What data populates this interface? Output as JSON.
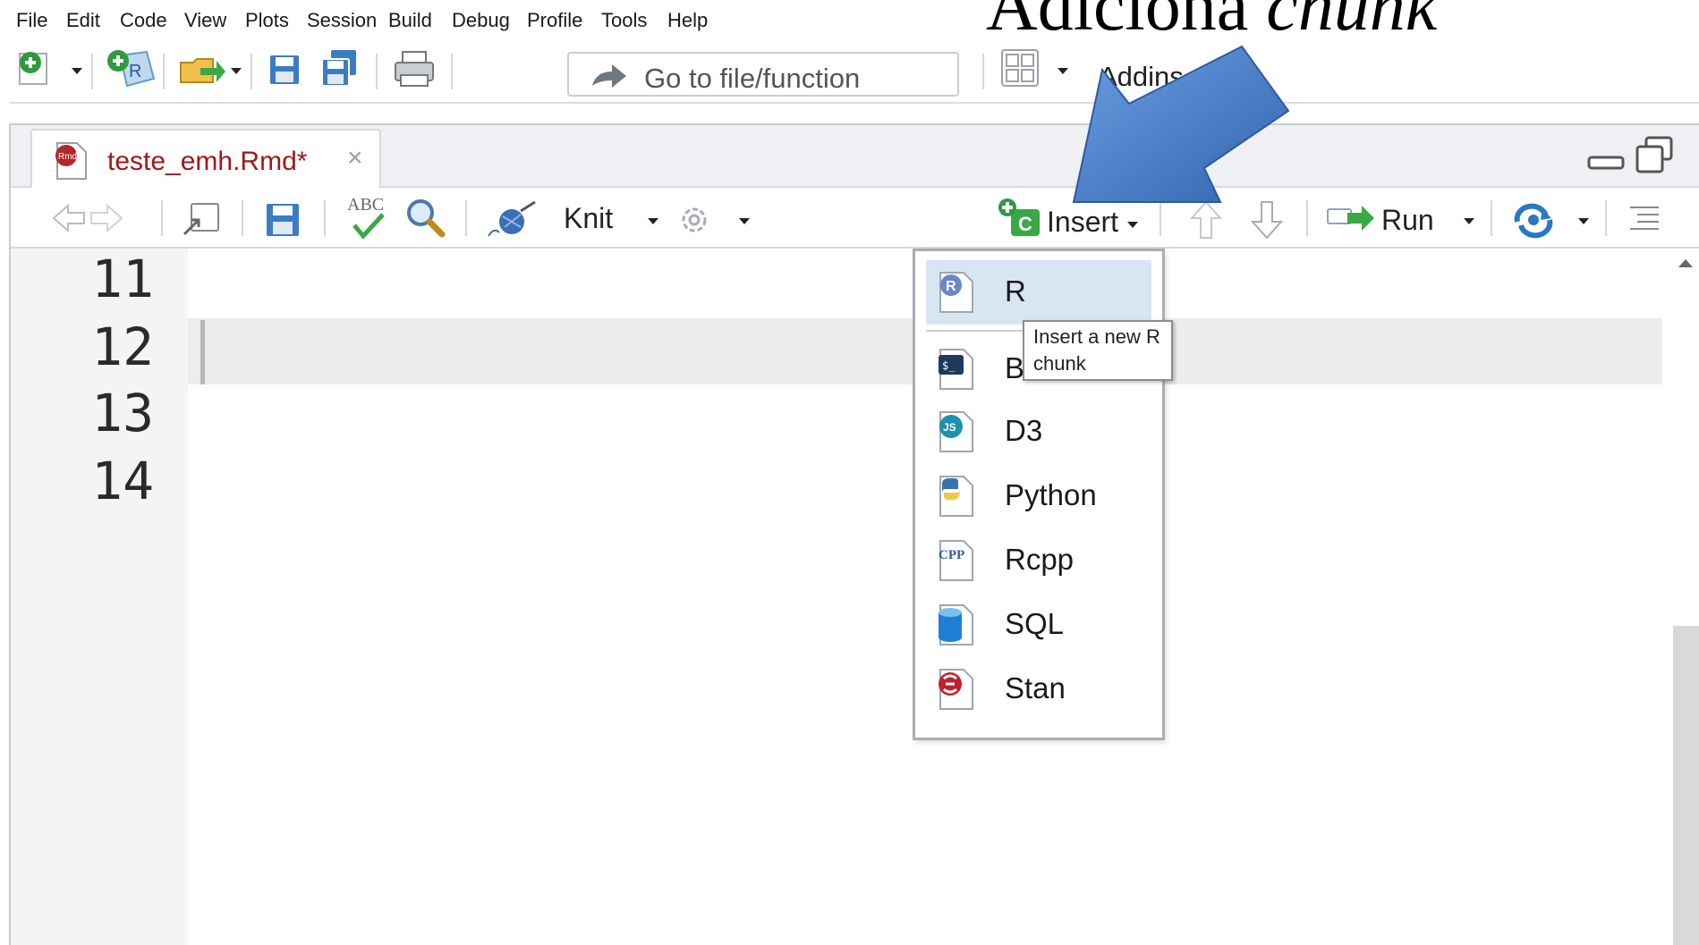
{
  "menubar": {
    "items": [
      "File",
      "Edit",
      "Code",
      "View",
      "Plots",
      "Session",
      "Build",
      "Debug",
      "Profile",
      "Tools",
      "Help"
    ]
  },
  "toolbar": {
    "goto_placeholder": "Go to file/function",
    "addins_label": "Addins"
  },
  "slide_title": {
    "prefix": "Adiciona ",
    "emphasis": "chunk"
  },
  "editor": {
    "tab_label": "teste_emh.Rmd*",
    "tab_close": "×",
    "knit_label": "Knit",
    "insert_label": "Insert",
    "run_label": "Run",
    "spellcheck_label": "ABC",
    "line_numbers": [
      "11",
      "12",
      "13",
      "14"
    ]
  },
  "chunk_menu": {
    "items": [
      {
        "label": "R",
        "icon": "r-chunk-icon"
      },
      {
        "label": "Bash",
        "icon": "bash-chunk-icon"
      },
      {
        "label": "D3",
        "icon": "d3-chunk-icon"
      },
      {
        "label": "Python",
        "icon": "python-chunk-icon"
      },
      {
        "label": "Rcpp",
        "icon": "rcpp-chunk-icon"
      },
      {
        "label": "SQL",
        "icon": "sql-chunk-icon"
      },
      {
        "label": "Stan",
        "icon": "stan-chunk-icon"
      }
    ],
    "selected": "R"
  },
  "tooltip": {
    "line1": "Insert a new R",
    "line2": "chunk"
  },
  "colors": {
    "accent_blue": "#3b7dc4",
    "arrow_blue": "#4a7fcb",
    "tab_text": "#a01818",
    "selection": "#d8e6f4"
  }
}
